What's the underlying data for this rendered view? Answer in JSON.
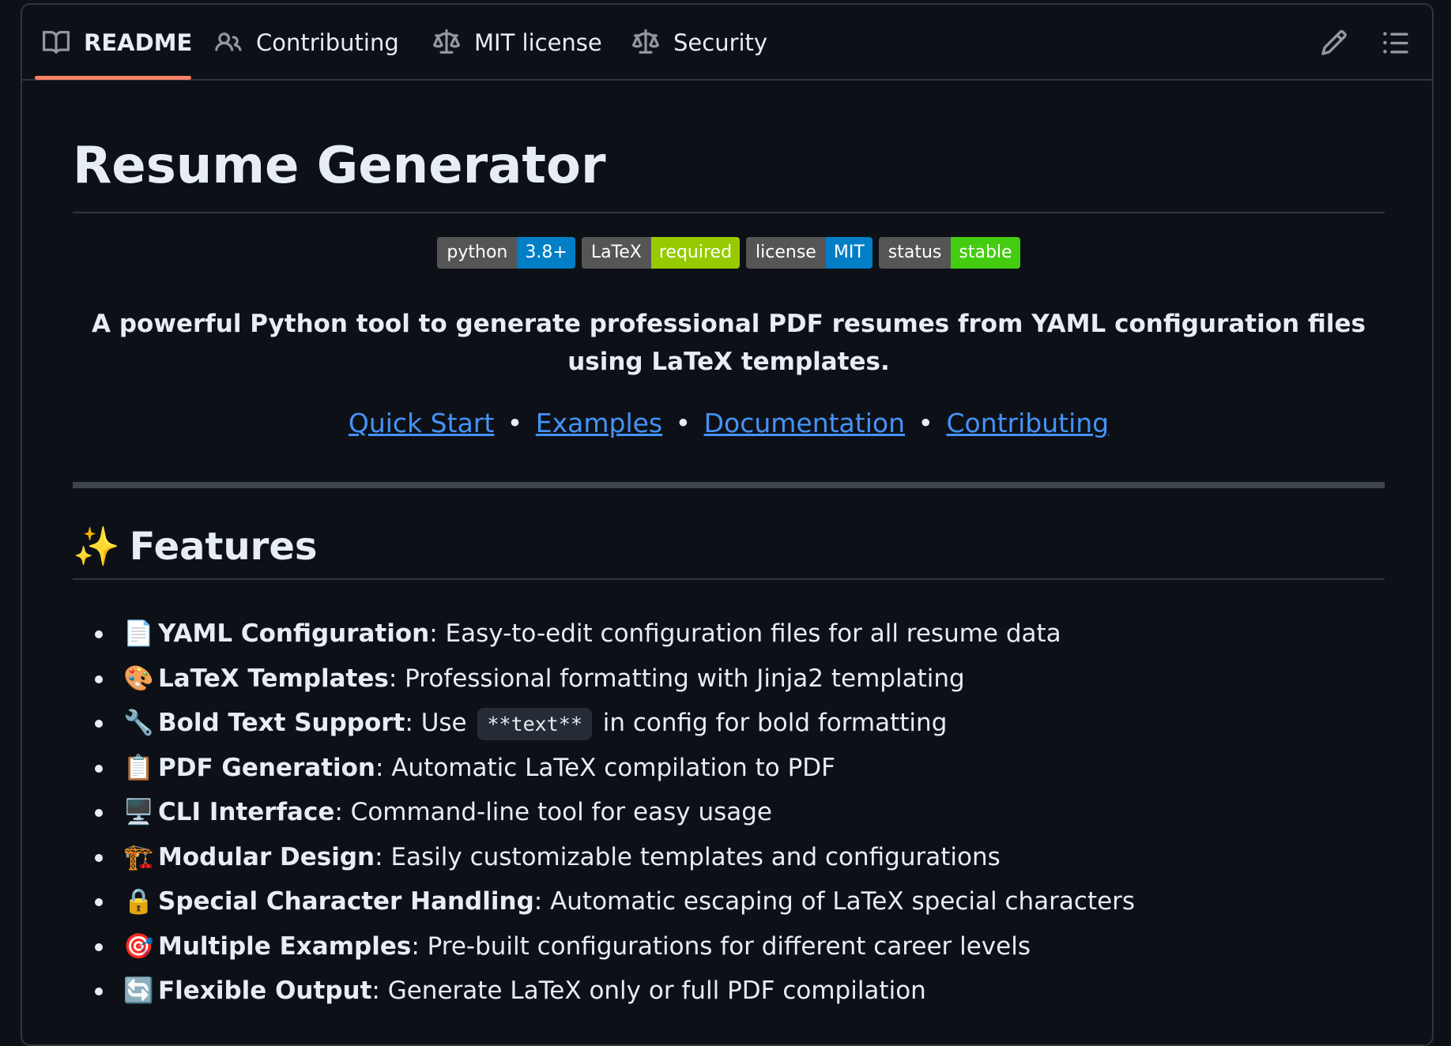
{
  "tabs": [
    {
      "label": "README",
      "icon": "book-icon",
      "active": true
    },
    {
      "label": "Contributing",
      "icon": "people-icon",
      "active": false
    },
    {
      "label": "MIT license",
      "icon": "law-icon",
      "active": false
    },
    {
      "label": "Security",
      "icon": "law-icon",
      "active": false
    }
  ],
  "toolbar": {
    "edit_icon": "pencil-icon",
    "outline_icon": "list-icon"
  },
  "title": "Resume Generator",
  "badges": [
    {
      "label": "python",
      "value": "3.8+",
      "color": "#007ec6"
    },
    {
      "label": "LaTeX",
      "value": "required",
      "color": "#97ca00"
    },
    {
      "label": "license",
      "value": "MIT",
      "color": "#007ec6"
    },
    {
      "label": "status",
      "value": "stable",
      "color": "#4c1"
    }
  ],
  "tagline": "A powerful Python tool to generate professional PDF resumes from YAML configuration files using LaTeX templates.",
  "links": [
    "Quick Start",
    "Examples",
    "Documentation",
    "Contributing"
  ],
  "link_separator": "•",
  "features_heading": {
    "emoji": "✨",
    "text": "Features"
  },
  "features": [
    {
      "emoji": "📄",
      "name": "YAML Configuration",
      "desc": ": Easy-to-edit configuration files for all resume data"
    },
    {
      "emoji": "🎨",
      "name": "LaTeX Templates",
      "desc": ": Professional formatting with Jinja2 templating"
    },
    {
      "emoji": "🔧",
      "name": "Bold Text Support",
      "desc_before": ": Use",
      "code": "**text**",
      "desc": "in config for bold formatting"
    },
    {
      "emoji": "📋",
      "name": "PDF Generation",
      "desc": ": Automatic LaTeX compilation to PDF"
    },
    {
      "emoji": "🖥️",
      "name": "CLI Interface",
      "desc": ": Command-line tool for easy usage"
    },
    {
      "emoji": "🏗️",
      "name": "Modular Design",
      "desc": ": Easily customizable templates and configurations"
    },
    {
      "emoji": "🔒",
      "name": "Special Character Handling",
      "desc": ": Automatic escaping of LaTeX special characters"
    },
    {
      "emoji": "🎯",
      "name": "Multiple Examples",
      "desc": ": Pre-built configurations for different career levels"
    },
    {
      "emoji": "🔄",
      "name": "Flexible Output",
      "desc": ": Generate LaTeX only or full PDF compilation"
    }
  ]
}
